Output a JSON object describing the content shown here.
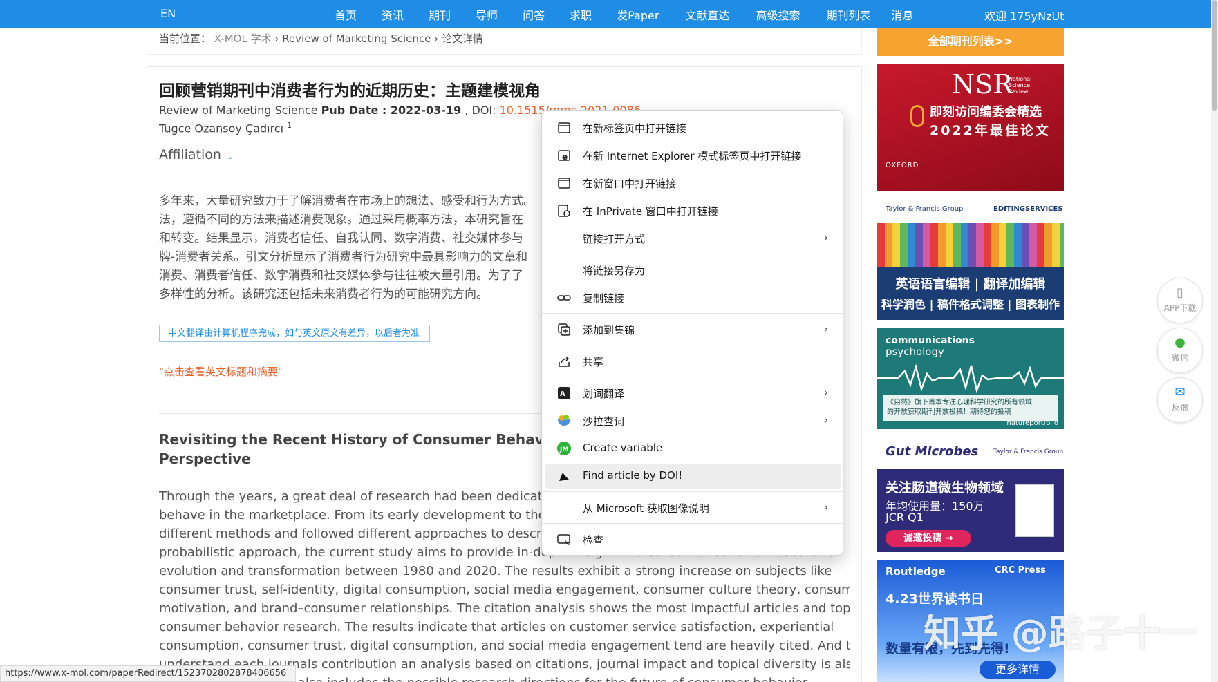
{
  "nav": {
    "lang": "EN",
    "items": [
      "首页",
      "资讯",
      "期刊",
      "导师",
      "问答",
      "求职",
      "发Paper",
      "文献直达",
      "高级搜索",
      "期刊列表",
      "消息"
    ],
    "welcome": "欢迎 175yNzUt"
  },
  "breadcrumb": {
    "label": "当前位置：",
    "site": "X-MOL 学术",
    "journal": "Review of Marketing Science",
    "current": "论文详情",
    "sep": "›"
  },
  "article": {
    "title_cn": "回顾营销期刊中消费者行为的近期历史：主题建模视角",
    "journal": "Review of Marketing Science",
    "pub_date_label": "Pub Date : 2022-03-19",
    "doi_label": ", DOI: ",
    "doi": "10.1515/roms-2021-0086",
    "author": "Tugce Ozansoy Çadırcı",
    "author_sup": "1",
    "affiliation": "Affiliation",
    "abstract_cn_lines": [
      "多年来，大量研究致力于了解消费者在市场上的想法、感受和行为方式。",
      "法，遵循不同的方法来描述消费现象。通过采用概率方法，本研究旨在",
      "和转变。结果显示，消费者信任、自我认同、数字消费、社交媒体参与",
      "牌-消费者关系。引文分析显示了消费者行为研究中最具影响力的文章和",
      "消费、消费者信任、数字消费和社交媒体参与往往被大量引用。为了了",
      "多样性的分析。该研究还包括未来消费者行为的可能研究方向。"
    ],
    "translation_notice": "中文翻译由计算机程序完成，如与英文原文有差异，以后者为准",
    "show_english": "\"点击查看英文标题和摘要\"",
    "title_en_lines": [
      "Revisiting the Recent History of Consumer Behavior in",
      "Perspective"
    ],
    "abstract_en_lines": [
      "Through the years, a great deal of research had been dedicated t",
      "behave in the marketplace. From its early development to the pr",
      "different methods and followed different approaches to describe",
      "probabilistic approach, the current study aims to provide in-depth insight into consumer behavior research's",
      "evolution and transformation between 1980 and 2020. The results exhibit a strong increase on subjects like",
      "consumer trust, self-identity, digital consumption, social media engagement, consumer culture theory, consumer",
      "motivation, and brand–consumer relationships. The citation analysis shows the most impactful articles and topics in",
      "consumer behavior research. The results indicate that articles on customer service satisfaction, experiential",
      "consumption, consumer trust, digital consumption, and social media engagement tend are heavily cited. And to",
      "understand each journals contribution an analysis based on citations, journal impact and topical diversity is also",
      "conducted. The study also includes the possible research directions for the future of consumer behavior."
    ]
  },
  "status_url": "https://www.x-mol.com/paperRedirect/1523702802878406656",
  "sidebar": {
    "all_journals": "全部期刊列表>>",
    "ad_nsr": {
      "logo": "NSR",
      "sub": "National Science Review",
      "line1": "即刻访问编委会精选",
      "line2": "2022年最佳论文",
      "publisher": "OXFORD"
    },
    "ad_editing": {
      "brand": "Taylor & Francis Group",
      "service": "EDITINGSERVICES",
      "line1": "英语语言编辑 | 翻译加编辑",
      "line2": "科学润色 | 稿件格式调整 | 图表制作"
    },
    "ad_commpsy": {
      "brand1": "communications",
      "brand2": "psychology",
      "foot1": "《自然》旗下首本专注心理科学研究的所有领域",
      "foot2": "的开放获取期刊开放投稿！期待您的投稿",
      "publisher": "natureportfolio"
    },
    "ad_gut": {
      "title": "Gut Microbes",
      "brand": "Taylor & Francis Group",
      "line1": "关注肠道微生物领域",
      "line2": "年均使用量：150万",
      "line3": "JCR Q1",
      "button": "诚邀投稿 ➜"
    },
    "ad_routledge": {
      "brand1": "Routledge",
      "brand2": "CRC Press",
      "line1": "4.23世界读书日",
      "line2": "数量有限，先到先得!",
      "button": "更多详情"
    }
  },
  "watermark": "知乎 @路子十一",
  "side_buttons": [
    {
      "label": "APP下载",
      "icon": "phone-icon"
    },
    {
      "label": "微信",
      "icon": "wechat-icon"
    },
    {
      "label": "反馈",
      "icon": "mail-icon"
    }
  ],
  "context_menu": {
    "items": [
      {
        "label": "在新标签页中打开链接",
        "icon": "new-tab-icon"
      },
      {
        "label": "在新 Internet Explorer 模式标签页中打开链接",
        "icon": "ie-icon"
      },
      {
        "label": "在新窗口中打开链接",
        "icon": "new-window-icon"
      },
      {
        "label": "在 InPrivate 窗口中打开链接",
        "icon": "inprivate-icon"
      },
      {
        "label": "链接打开方式",
        "icon": ""
      },
      {
        "label": "将链接另存为",
        "icon": ""
      },
      {
        "label": "复制链接",
        "icon": "link-icon"
      },
      {
        "label": "添加到集锦",
        "icon": "collections-icon"
      },
      {
        "label": "共享",
        "icon": "share-icon"
      },
      {
        "label": "划词翻译",
        "icon": "translate-icon"
      },
      {
        "label": "沙拉查词",
        "icon": "saladict-icon"
      },
      {
        "label": "Create variable",
        "icon": "variable-icon"
      },
      {
        "label": "Find article by DOI!",
        "icon": "doi-icon"
      },
      {
        "label": "从 Microsoft 获取图像说明",
        "icon": ""
      },
      {
        "label": "检查",
        "icon": "inspect-icon"
      }
    ],
    "arrow": "›"
  }
}
